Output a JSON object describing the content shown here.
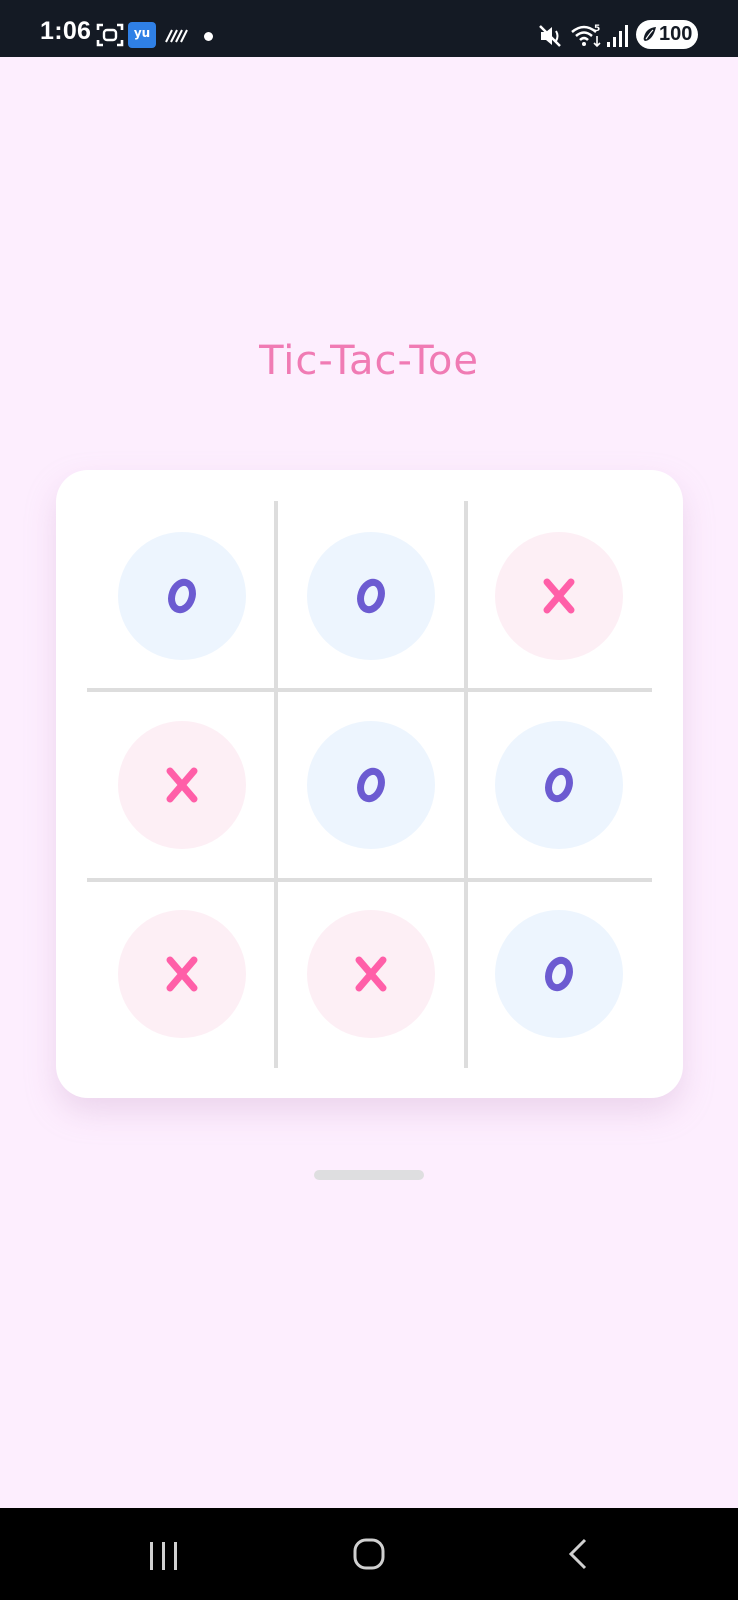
{
  "status_bar": {
    "time": "1:06",
    "app_badge": "yu",
    "battery_level": "100",
    "icons": [
      "screenshot-icon",
      "app-icon",
      "hatch-icon",
      "notification-dot",
      "mute-icon",
      "wifi-icon",
      "signal-icon",
      "battery-icon"
    ]
  },
  "title": "Tic-Tac-Toe",
  "colors": {
    "background": "#fdeefe",
    "title": "#f07bb4",
    "x_mark": "#ff5fa8",
    "o_mark": "#6c5bd1",
    "x_circle": "#fdeff5",
    "o_circle": "#edf5fe"
  },
  "board": {
    "cells": [
      {
        "mark": "O"
      },
      {
        "mark": "O"
      },
      {
        "mark": "X"
      },
      {
        "mark": "X"
      },
      {
        "mark": "O"
      },
      {
        "mark": "O"
      },
      {
        "mark": "X"
      },
      {
        "mark": "X"
      },
      {
        "mark": "O"
      }
    ]
  },
  "nav_bar": {
    "buttons": [
      "recents-icon",
      "home-icon",
      "back-icon"
    ]
  }
}
